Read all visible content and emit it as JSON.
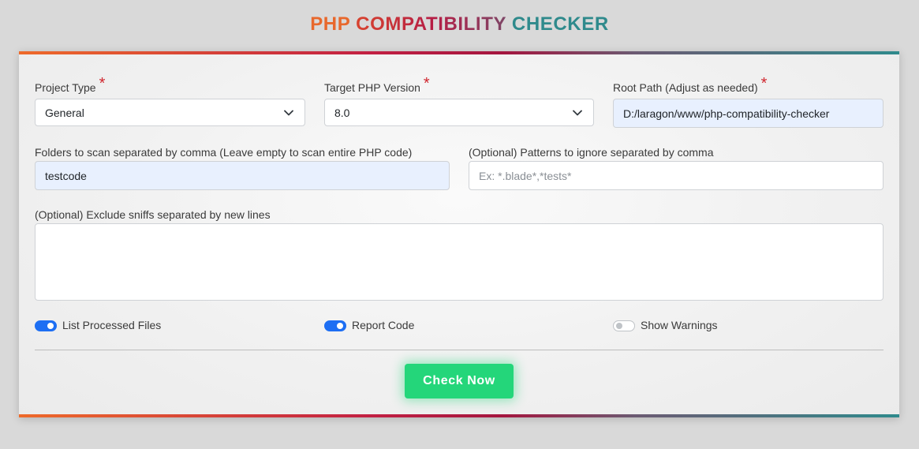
{
  "header": {
    "title_parts": [
      {
        "text": "PHP ",
        "color": "#e8682c"
      },
      {
        "text": "COMPATIBILITY ",
        "color": "#c8223e"
      },
      {
        "text": "CHECKER",
        "color": "#2f8a8c"
      }
    ]
  },
  "form": {
    "project_type": {
      "label": "Project Type",
      "required_mark": "*",
      "value": "General"
    },
    "target_php_version": {
      "label": "Target PHP Version",
      "required_mark": "*",
      "value": "8.0"
    },
    "root_path": {
      "label": "Root Path (Adjust as needed)",
      "required_mark": "*",
      "value": "D:/laragon/www/php-compatibility-checker"
    },
    "folders": {
      "label": "Folders to scan separated by comma (Leave empty to scan entire PHP code)",
      "value": "testcode"
    },
    "ignore_patterns": {
      "label": "(Optional) Patterns to ignore separated by comma",
      "placeholder": "Ex: *.blade*,*tests*",
      "value": ""
    },
    "exclude_sniffs": {
      "label": "(Optional) Exclude sniffs separated by new lines",
      "value": ""
    },
    "toggles": [
      {
        "label": "List Processed Files",
        "checked": true
      },
      {
        "label": "Report Code",
        "checked": true
      },
      {
        "label": "Show Warnings",
        "checked": false
      }
    ],
    "submit_label": "Check Now"
  },
  "colors": {
    "accent_blue": "#1d6ef3",
    "button_green": "#24d67a",
    "required_red": "#d0262e",
    "autofill_bg": "#e8f0fe"
  },
  "icons": {
    "select_arrow": "chevron-down-icon"
  }
}
